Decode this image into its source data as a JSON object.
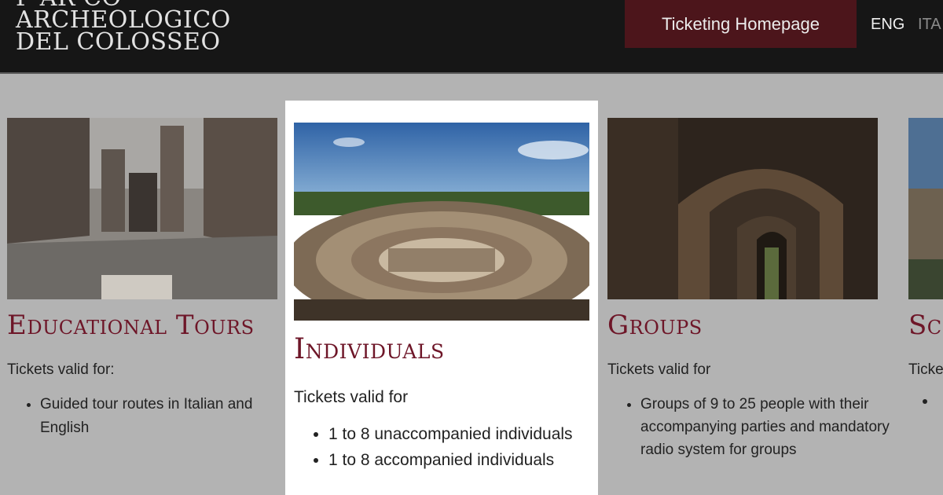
{
  "header": {
    "logo_lines": [
      "P·AR·CO",
      "ARCHEOLOGICO",
      "DEL COLOSSEO"
    ],
    "ticketing_button": "Ticketing Homepage",
    "languages": [
      "ENG",
      "ITA"
    ]
  },
  "cards": [
    {
      "title": "Educational Tours",
      "valid_label": "Tickets valid for:",
      "items": [
        "Guided tour routes in Italian and English"
      ]
    },
    {
      "title": "Individuals",
      "valid_label": "Tickets valid for",
      "items": [
        "1 to 8 unaccompanied individuals",
        "1 to 8 accompanied individuals"
      ]
    },
    {
      "title": "Groups",
      "valid_label": "Tickets valid for",
      "items": [
        "Groups of 9 to 25 people with their accompanying parties and mandatory radio system for groups"
      ]
    },
    {
      "title": "Sc",
      "valid_label": "Ticke"
    }
  ],
  "colors": {
    "header_bg": "#161616",
    "button_bg": "#4c151b",
    "title_color": "#6e1628",
    "page_bg": "#b3b3b3"
  }
}
